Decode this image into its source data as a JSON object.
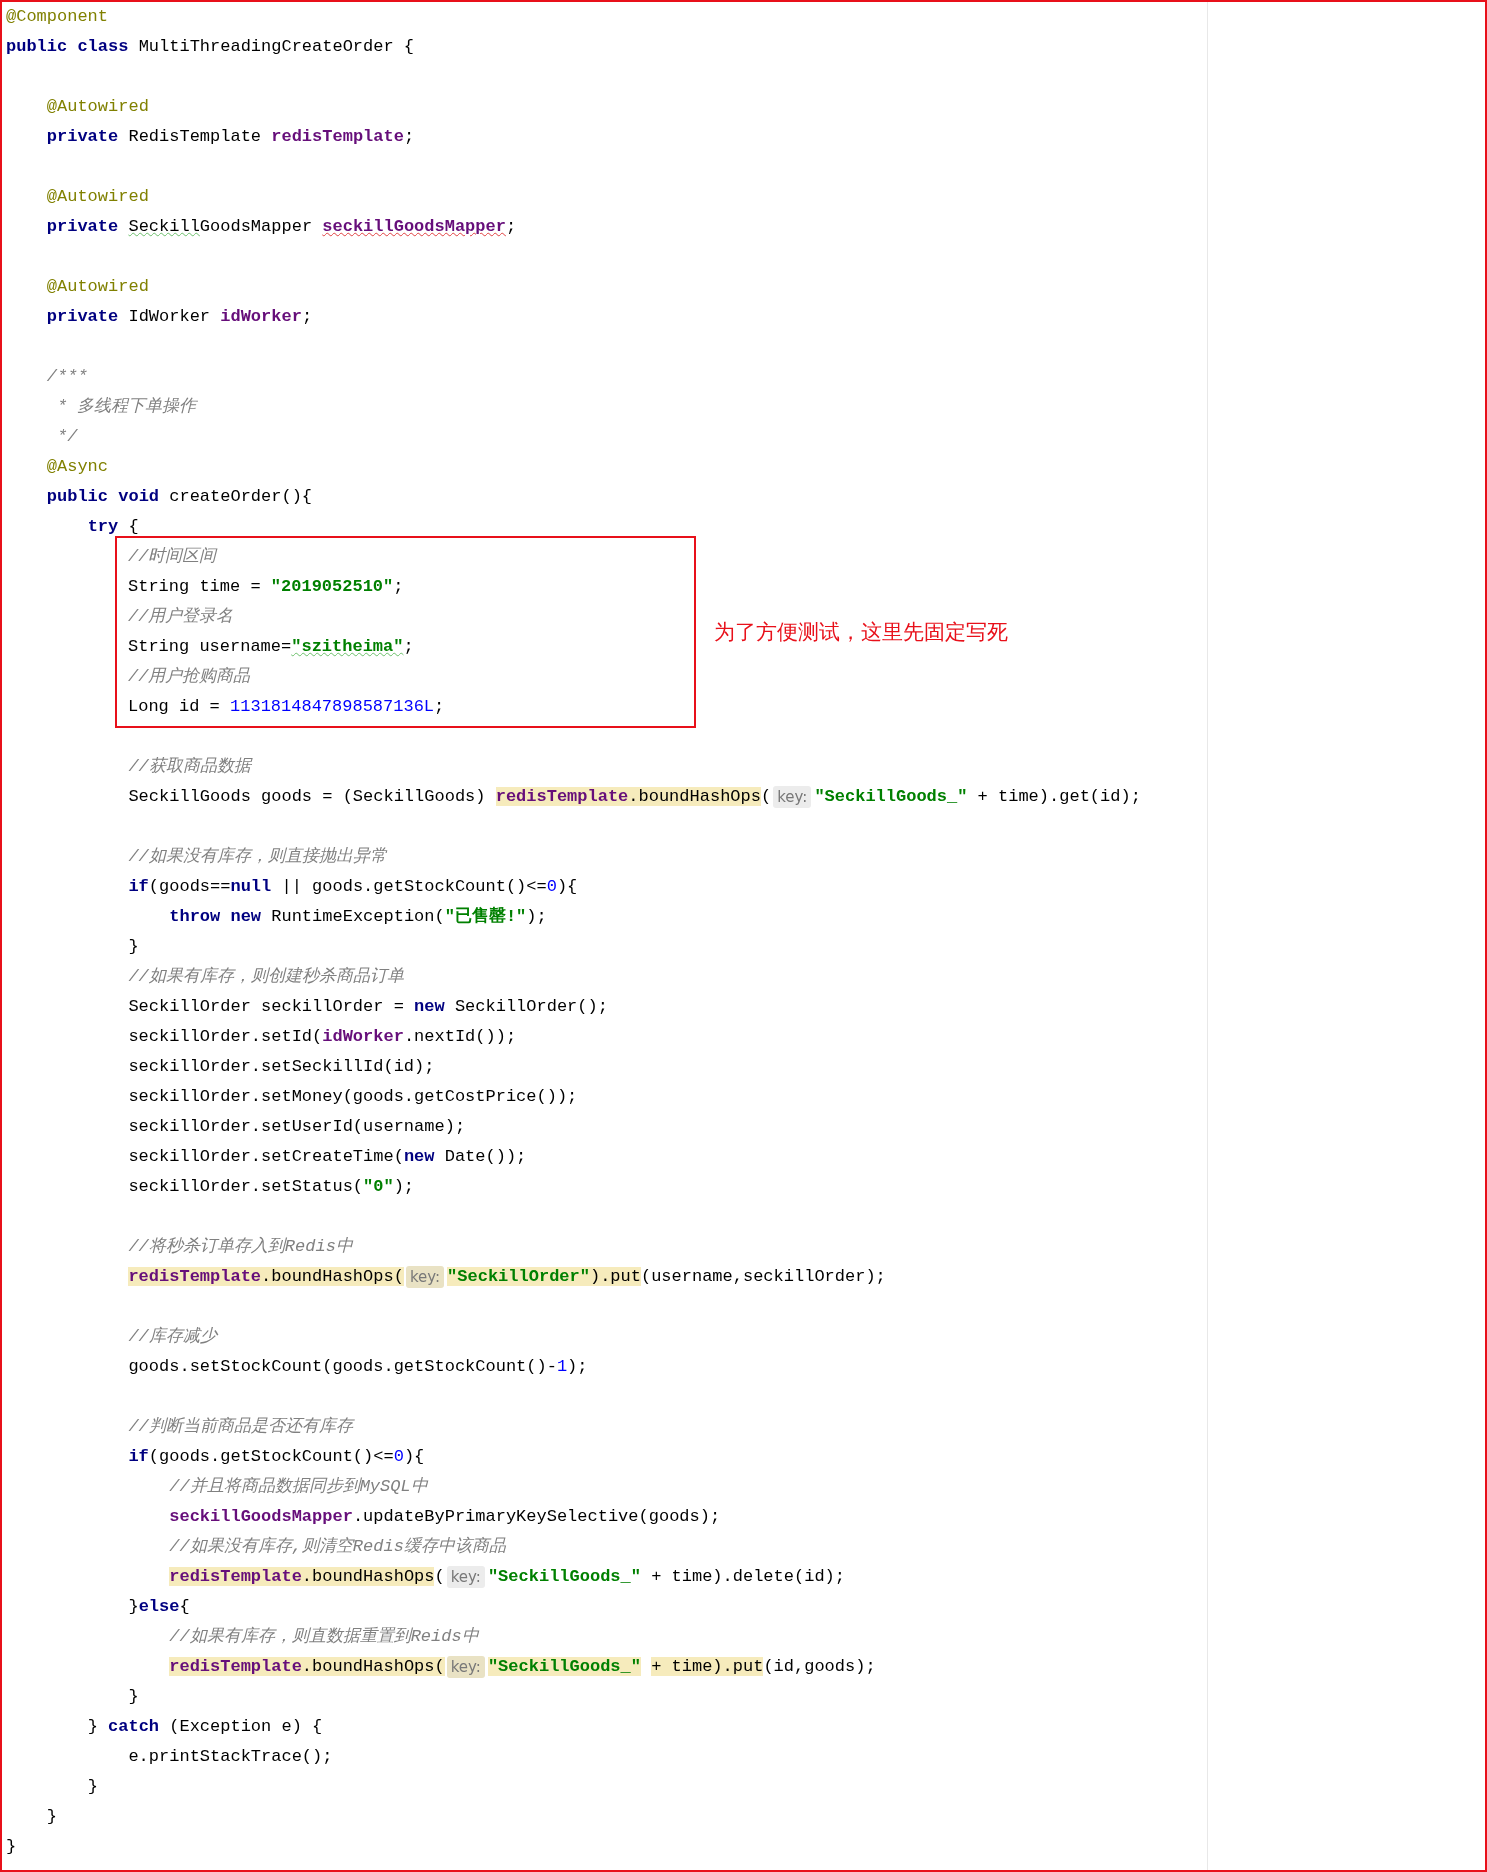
{
  "editor": {
    "sections": [
      {
        "kind": "lines",
        "lines": [
          {
            "kind": "code",
            "tokens": [
              {
                "kind": "annotation",
                "text": "@Component"
              }
            ]
          },
          {
            "kind": "code",
            "tokens": [
              {
                "kind": "keyword",
                "text": "public class"
              },
              {
                "kind": "plain",
                "text": " MultiThreadingCreateOrder {"
              }
            ]
          },
          {
            "kind": "blank"
          },
          {
            "kind": "code",
            "tokens": [
              {
                "kind": "annotation",
                "text": "    @Autowired"
              }
            ]
          },
          {
            "kind": "code",
            "tokens": [
              {
                "kind": "keyword",
                "text": "    private"
              },
              {
                "kind": "plain",
                "text": " RedisTemplate "
              },
              {
                "kind": "field",
                "text": "redisTemplate"
              },
              {
                "kind": "plain",
                "text": ";"
              }
            ]
          },
          {
            "kind": "blank"
          },
          {
            "kind": "code",
            "tokens": [
              {
                "kind": "annotation",
                "text": "    @Autowired"
              }
            ]
          },
          {
            "kind": "code",
            "tokens": [
              {
                "kind": "keyword",
                "text": "    private"
              },
              {
                "kind": "plain",
                "text": " Seckill",
                "spelling_warning": true
              },
              {
                "kind": "plain",
                "text": "GoodsMapper "
              },
              {
                "kind": "field",
                "text": "seckillGoodsMapper",
                "error": true
              },
              {
                "kind": "plain",
                "text": ";"
              }
            ]
          },
          {
            "kind": "blank"
          },
          {
            "kind": "code",
            "tokens": [
              {
                "kind": "annotation",
                "text": "    @Autowired"
              }
            ]
          },
          {
            "kind": "code",
            "tokens": [
              {
                "kind": "keyword",
                "text": "    private"
              },
              {
                "kind": "plain",
                "text": " IdWorker "
              },
              {
                "kind": "field",
                "text": "idWorker"
              },
              {
                "kind": "plain",
                "text": ";"
              }
            ]
          },
          {
            "kind": "blank"
          },
          {
            "kind": "code",
            "tokens": [
              {
                "kind": "comment",
                "text": "    /***"
              }
            ]
          },
          {
            "kind": "code",
            "tokens": [
              {
                "kind": "comment",
                "text": "     * 多线程下单操作"
              }
            ]
          },
          {
            "kind": "code",
            "tokens": [
              {
                "kind": "comment",
                "text": "     */"
              }
            ]
          },
          {
            "kind": "code",
            "tokens": [
              {
                "kind": "annotation",
                "text": "    @Async"
              }
            ]
          },
          {
            "kind": "code",
            "tokens": [
              {
                "kind": "keyword",
                "text": "    public void"
              },
              {
                "kind": "plain",
                "text": " createOrder(){"
              }
            ]
          },
          {
            "kind": "code",
            "tokens": [
              {
                "kind": "keyword",
                "text": "        try"
              },
              {
                "kind": "plain",
                "text": " {"
              }
            ]
          }
        ]
      },
      {
        "kind": "callout",
        "note": "为了方便测试，这里先固定写死",
        "lines": [
          {
            "kind": "code",
            "tokens": [
              {
                "kind": "comment",
                "text": "//时间区间"
              }
            ]
          },
          {
            "kind": "code",
            "tokens": [
              {
                "kind": "plain",
                "text": "String time = "
              },
              {
                "kind": "string",
                "text": "\"2019052510\""
              },
              {
                "kind": "plain",
                "text": ";"
              }
            ]
          },
          {
            "kind": "code",
            "tokens": [
              {
                "kind": "comment",
                "text": "//用户登录名"
              }
            ]
          },
          {
            "kind": "code",
            "tokens": [
              {
                "kind": "plain",
                "text": "String username="
              },
              {
                "kind": "string",
                "text": "\"szitheima\"",
                "spelling_warning": true
              },
              {
                "kind": "plain",
                "text": ";"
              }
            ]
          },
          {
            "kind": "code",
            "tokens": [
              {
                "kind": "comment",
                "text": "//用户抢购商品"
              }
            ]
          },
          {
            "kind": "code",
            "tokens": [
              {
                "kind": "plain",
                "text": "Long id = "
              },
              {
                "kind": "number",
                "text": "1131814847898587136L"
              },
              {
                "kind": "plain",
                "text": ";"
              }
            ]
          }
        ]
      },
      {
        "kind": "lines",
        "lines": [
          {
            "kind": "blank"
          },
          {
            "kind": "code",
            "tokens": [
              {
                "kind": "comment",
                "text": "            //获取商品数据"
              }
            ]
          },
          {
            "kind": "code",
            "tokens": [
              {
                "kind": "plain",
                "text": "            SeckillGoods goods = (SeckillGoods) ",
                "highlighted": false
              },
              {
                "kind": "field",
                "text": "redisTemplate",
                "highlighted": true
              },
              {
                "kind": "plain",
                "text": ".boundHashOps",
                "highlighted": true
              },
              {
                "kind": "plain",
                "text": "(",
                "highlighted": false
              },
              {
                "kind": "hint",
                "text": "key:",
                "highlighted": false
              },
              {
                "kind": "string",
                "text": "\"SeckillGoods_\"",
                "highlighted": false
              },
              {
                "kind": "plain",
                "text": " + time).get(id);",
                "highlighted": false
              }
            ]
          },
          {
            "kind": "blank"
          },
          {
            "kind": "code",
            "tokens": [
              {
                "kind": "comment",
                "text": "            //如果没有库存，则直接抛出异常"
              }
            ]
          },
          {
            "kind": "code",
            "tokens": [
              {
                "kind": "keyword",
                "text": "            if"
              },
              {
                "kind": "plain",
                "text": "(goods=="
              },
              {
                "kind": "keyword",
                "text": "null"
              },
              {
                "kind": "plain",
                "text": " || goods.getStockCount()<="
              },
              {
                "kind": "number",
                "text": "0"
              },
              {
                "kind": "plain",
                "text": "){"
              }
            ]
          },
          {
            "kind": "code",
            "tokens": [
              {
                "kind": "keyword",
                "text": "                throw new"
              },
              {
                "kind": "plain",
                "text": " RuntimeException("
              },
              {
                "kind": "string",
                "text": "\"已售罄!\""
              },
              {
                "kind": "plain",
                "text": ");"
              }
            ]
          },
          {
            "kind": "code",
            "tokens": [
              {
                "kind": "plain",
                "text": "            }"
              }
            ]
          },
          {
            "kind": "code",
            "tokens": [
              {
                "kind": "comment",
                "text": "            //如果有库存，则创建秒杀商品订单"
              }
            ]
          },
          {
            "kind": "code",
            "tokens": [
              {
                "kind": "plain",
                "text": "            SeckillOrder seckillOrder = "
              },
              {
                "kind": "keyword",
                "text": "new"
              },
              {
                "kind": "plain",
                "text": " SeckillOrder();"
              }
            ]
          },
          {
            "kind": "code",
            "tokens": [
              {
                "kind": "plain",
                "text": "            seckillOrder.setId("
              },
              {
                "kind": "field",
                "text": "idWorker"
              },
              {
                "kind": "plain",
                "text": ".nextId());"
              }
            ]
          },
          {
            "kind": "code",
            "tokens": [
              {
                "kind": "plain",
                "text": "            seckillOrder.setSeckillId(id);"
              }
            ]
          },
          {
            "kind": "code",
            "tokens": [
              {
                "kind": "plain",
                "text": "            seckillOrder.setMoney(goods.getCostPrice());"
              }
            ]
          },
          {
            "kind": "code",
            "tokens": [
              {
                "kind": "plain",
                "text": "            seckillOrder.setUserId(username);"
              }
            ]
          },
          {
            "kind": "code",
            "tokens": [
              {
                "kind": "plain",
                "text": "            seckillOrder.setCreateTime("
              },
              {
                "kind": "keyword",
                "text": "new"
              },
              {
                "kind": "plain",
                "text": " Date());"
              }
            ]
          },
          {
            "kind": "code",
            "tokens": [
              {
                "kind": "plain",
                "text": "            seckillOrder.setStatus("
              },
              {
                "kind": "string",
                "text": "\"0\""
              },
              {
                "kind": "plain",
                "text": ");"
              }
            ]
          },
          {
            "kind": "blank"
          },
          {
            "kind": "code",
            "tokens": [
              {
                "kind": "comment",
                "text": "            //将秒杀订单存入到Redis中"
              }
            ]
          },
          {
            "kind": "code",
            "tokens": [
              {
                "kind": "field",
                "text": "            redisTemplate",
                "highlighted": true
              },
              {
                "kind": "plain",
                "text": ".boundHashOps(",
                "highlighted": true
              },
              {
                "kind": "hint",
                "text": "key:",
                "highlighted": true
              },
              {
                "kind": "string",
                "text": "\"SeckillOrder\"",
                "highlighted": true
              },
              {
                "kind": "plain",
                "text": ").put",
                "highlighted": true
              },
              {
                "kind": "plain",
                "text": "(username,seckillOrder);",
                "highlighted": false
              }
            ]
          },
          {
            "kind": "blank"
          },
          {
            "kind": "code",
            "tokens": [
              {
                "kind": "comment",
                "text": "            //库存减少"
              }
            ]
          },
          {
            "kind": "code",
            "tokens": [
              {
                "kind": "plain",
                "text": "            goods.setStockCount(goods.getStockCount()-"
              },
              {
                "kind": "number",
                "text": "1"
              },
              {
                "kind": "plain",
                "text": ");"
              }
            ]
          },
          {
            "kind": "blank"
          },
          {
            "kind": "code",
            "tokens": [
              {
                "kind": "comment",
                "text": "            //判断当前商品是否还有库存"
              }
            ]
          },
          {
            "kind": "code",
            "tokens": [
              {
                "kind": "keyword",
                "text": "            if"
              },
              {
                "kind": "plain",
                "text": "(goods.getStockCount()<="
              },
              {
                "kind": "number",
                "text": "0"
              },
              {
                "kind": "plain",
                "text": "){"
              }
            ]
          },
          {
            "kind": "code",
            "tokens": [
              {
                "kind": "comment",
                "text": "                //并且将商品数据同步到MySQL中"
              }
            ]
          },
          {
            "kind": "code",
            "tokens": [
              {
                "kind": "field",
                "text": "                seckillGoodsMapper"
              },
              {
                "kind": "plain",
                "text": ".updateByPrimaryKeySelective(goods);"
              }
            ]
          },
          {
            "kind": "code",
            "tokens": [
              {
                "kind": "comment",
                "text": "                //如果没有库存,则清空Redis缓存中该商品"
              }
            ]
          },
          {
            "kind": "code",
            "tokens": [
              {
                "kind": "field",
                "text": "                redisTemplate",
                "highlighted": true
              },
              {
                "kind": "plain",
                "text": ".boundHashOps",
                "highlighted": true
              },
              {
                "kind": "plain",
                "text": "(",
                "highlighted": false
              },
              {
                "kind": "hint",
                "text": "key:",
                "highlighted": false
              },
              {
                "kind": "string",
                "text": "\"SeckillGoods_\"",
                "highlighted": false
              },
              {
                "kind": "plain",
                "text": " + time).delete(id);",
                "highlighted": false
              }
            ]
          },
          {
            "kind": "code",
            "tokens": [
              {
                "kind": "plain",
                "text": "            }"
              },
              {
                "kind": "keyword",
                "text": "else"
              },
              {
                "kind": "plain",
                "text": "{"
              }
            ]
          },
          {
            "kind": "code",
            "tokens": [
              {
                "kind": "comment",
                "text": "                //如果有库存，则直数据重置到Reids中"
              }
            ]
          },
          {
            "kind": "code",
            "tokens": [
              {
                "kind": "field",
                "text": "                redisTemplate",
                "highlighted": true
              },
              {
                "kind": "plain",
                "text": ".boundHashOps(",
                "highlighted": true
              },
              {
                "kind": "hint",
                "text": "key:",
                "highlighted": true
              },
              {
                "kind": "string",
                "text": "\"SeckillGoods_\"",
                "highlighted": true
              },
              {
                "kind": "plain",
                "text": " + time).put",
                "highlighted": true
              },
              {
                "kind": "plain",
                "text": "(id,goods);",
                "highlighted": false
              }
            ]
          },
          {
            "kind": "code",
            "tokens": [
              {
                "kind": "plain",
                "text": "            }"
              }
            ]
          },
          {
            "kind": "code",
            "tokens": [
              {
                "kind": "plain",
                "text": "        } "
              },
              {
                "kind": "keyword",
                "text": "catch"
              },
              {
                "kind": "plain",
                "text": " (Exception e) {"
              }
            ]
          },
          {
            "kind": "code",
            "tokens": [
              {
                "kind": "plain",
                "text": "            e.printStackTrace();"
              }
            ]
          },
          {
            "kind": "code",
            "tokens": [
              {
                "kind": "plain",
                "text": "        }"
              }
            ]
          },
          {
            "kind": "code",
            "tokens": [
              {
                "kind": "plain",
                "text": "    }"
              }
            ]
          },
          {
            "kind": "code",
            "tokens": [
              {
                "kind": "plain",
                "text": "}"
              }
            ]
          }
        ]
      }
    ]
  }
}
